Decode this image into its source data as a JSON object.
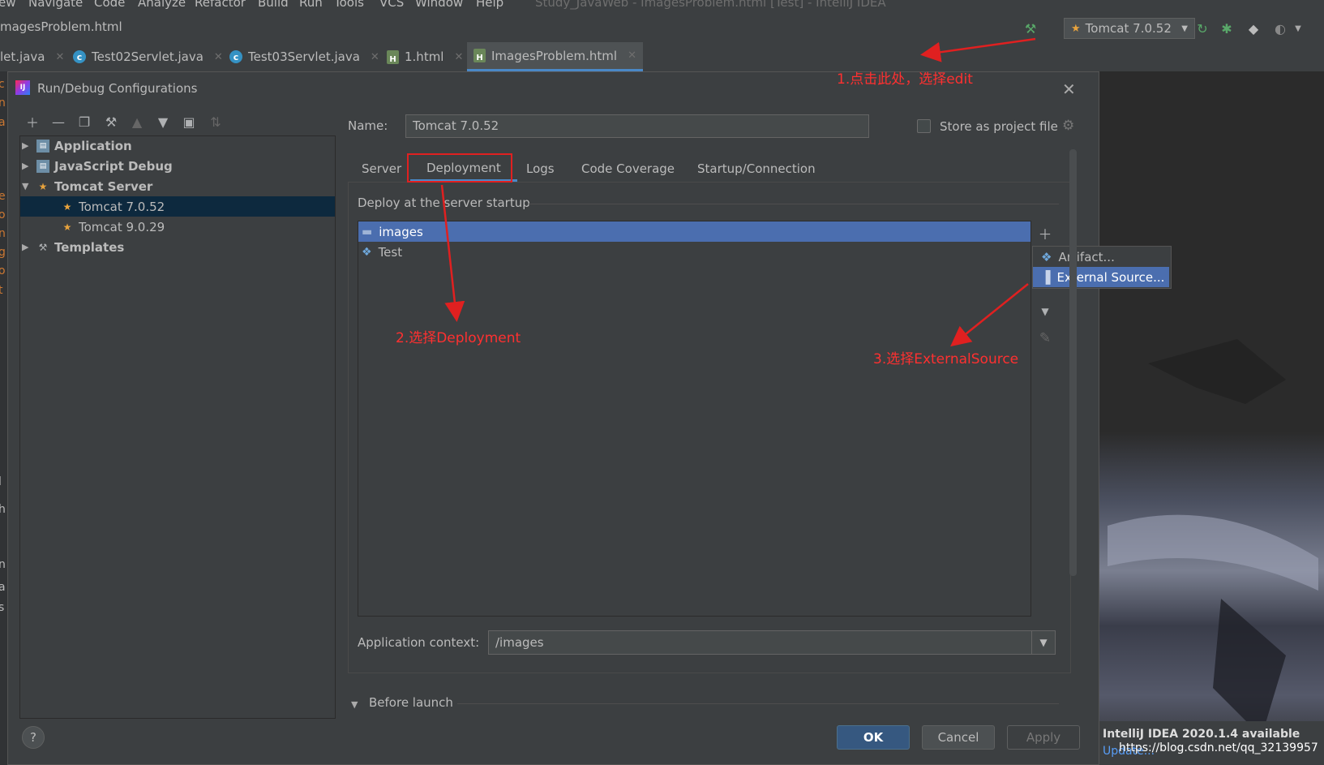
{
  "menubar": {
    "items": [
      "ew",
      "Navigate",
      "Code",
      "Analyze",
      "Refactor",
      "Build",
      "Run",
      "Tools",
      "VCS",
      "Window",
      "Help"
    ],
    "window_title": "Study_JavaWeb - ImagesProblem.html [Test] - IntelliJ IDEA"
  },
  "navbar": {
    "breadcrumb": "magesProblem.html"
  },
  "toolbar": {
    "run_config": "Tomcat 7.0.52"
  },
  "editor_tabs": [
    {
      "label": "let.java",
      "icon": "java-class-icon"
    },
    {
      "label": "Test02Servlet.java",
      "icon": "java-class-icon"
    },
    {
      "label": "Test03Servlet.java",
      "icon": "java-class-icon"
    },
    {
      "label": "1.html",
      "icon": "html-file-icon"
    },
    {
      "label": "ImagesProblem.html",
      "icon": "html-file-icon",
      "active": true
    }
  ],
  "left_strip_chars": [
    "c",
    "n",
    "a",
    "e",
    "o",
    "n",
    "g",
    "o",
    "t",
    "l",
    "h",
    "n",
    "a",
    "s"
  ],
  "dialog": {
    "title": "Run/Debug Configurations",
    "tree": [
      {
        "label": "Application",
        "level": 0,
        "expanded": false,
        "bold": true,
        "icon": "application-icon"
      },
      {
        "label": "JavaScript Debug",
        "level": 0,
        "expanded": false,
        "bold": true,
        "icon": "javascript-debug-icon"
      },
      {
        "label": "Tomcat Server",
        "level": 0,
        "expanded": true,
        "bold": true,
        "icon": "tomcat-icon"
      },
      {
        "label": "Tomcat 7.0.52",
        "level": 1,
        "selected": true,
        "icon": "tomcat-icon"
      },
      {
        "label": "Tomcat 9.0.29",
        "level": 1,
        "icon": "tomcat-icon"
      },
      {
        "label": "Templates",
        "level": 0,
        "expanded": false,
        "bold": true,
        "icon": "wrench-icon"
      }
    ],
    "name_label": "Name:",
    "name_value": "Tomcat 7.0.52",
    "store_label": "Store as project file",
    "tabs": [
      "Server",
      "Deployment",
      "Logs",
      "Code Coverage",
      "Startup/Connection"
    ],
    "active_tab": "Deployment",
    "deploy_section": "Deploy at the server startup",
    "deploy_items": [
      {
        "label": "images",
        "selected": true,
        "icon": "folder-icon"
      },
      {
        "label": "Test",
        "selected": false,
        "icon": "artifact-icon"
      }
    ],
    "add_menu": [
      {
        "label": "Artifact...",
        "icon": "artifact-icon"
      },
      {
        "label": "External Source...",
        "icon": "external-source-icon",
        "selected": true
      }
    ],
    "app_context_label": "Application context:",
    "app_context_value": "/images",
    "before_launch": "Before launch",
    "buttons": {
      "ok": "OK",
      "cancel": "Cancel",
      "apply": "Apply"
    }
  },
  "notification": {
    "title": "IntelliJ IDEA 2020.1.4 available",
    "link": "Update...",
    "watermark": "https://blog.csdn.net/qq_32139957"
  },
  "annotations": [
    {
      "text": "1.点击此处，选择edit"
    },
    {
      "text": "2.选择Deployment"
    },
    {
      "text": "3.选择ExternalSource"
    }
  ],
  "colors": {
    "accent": "#4b6eaf",
    "annotation": "#ff3030",
    "tree_selection": "#0d293e"
  }
}
